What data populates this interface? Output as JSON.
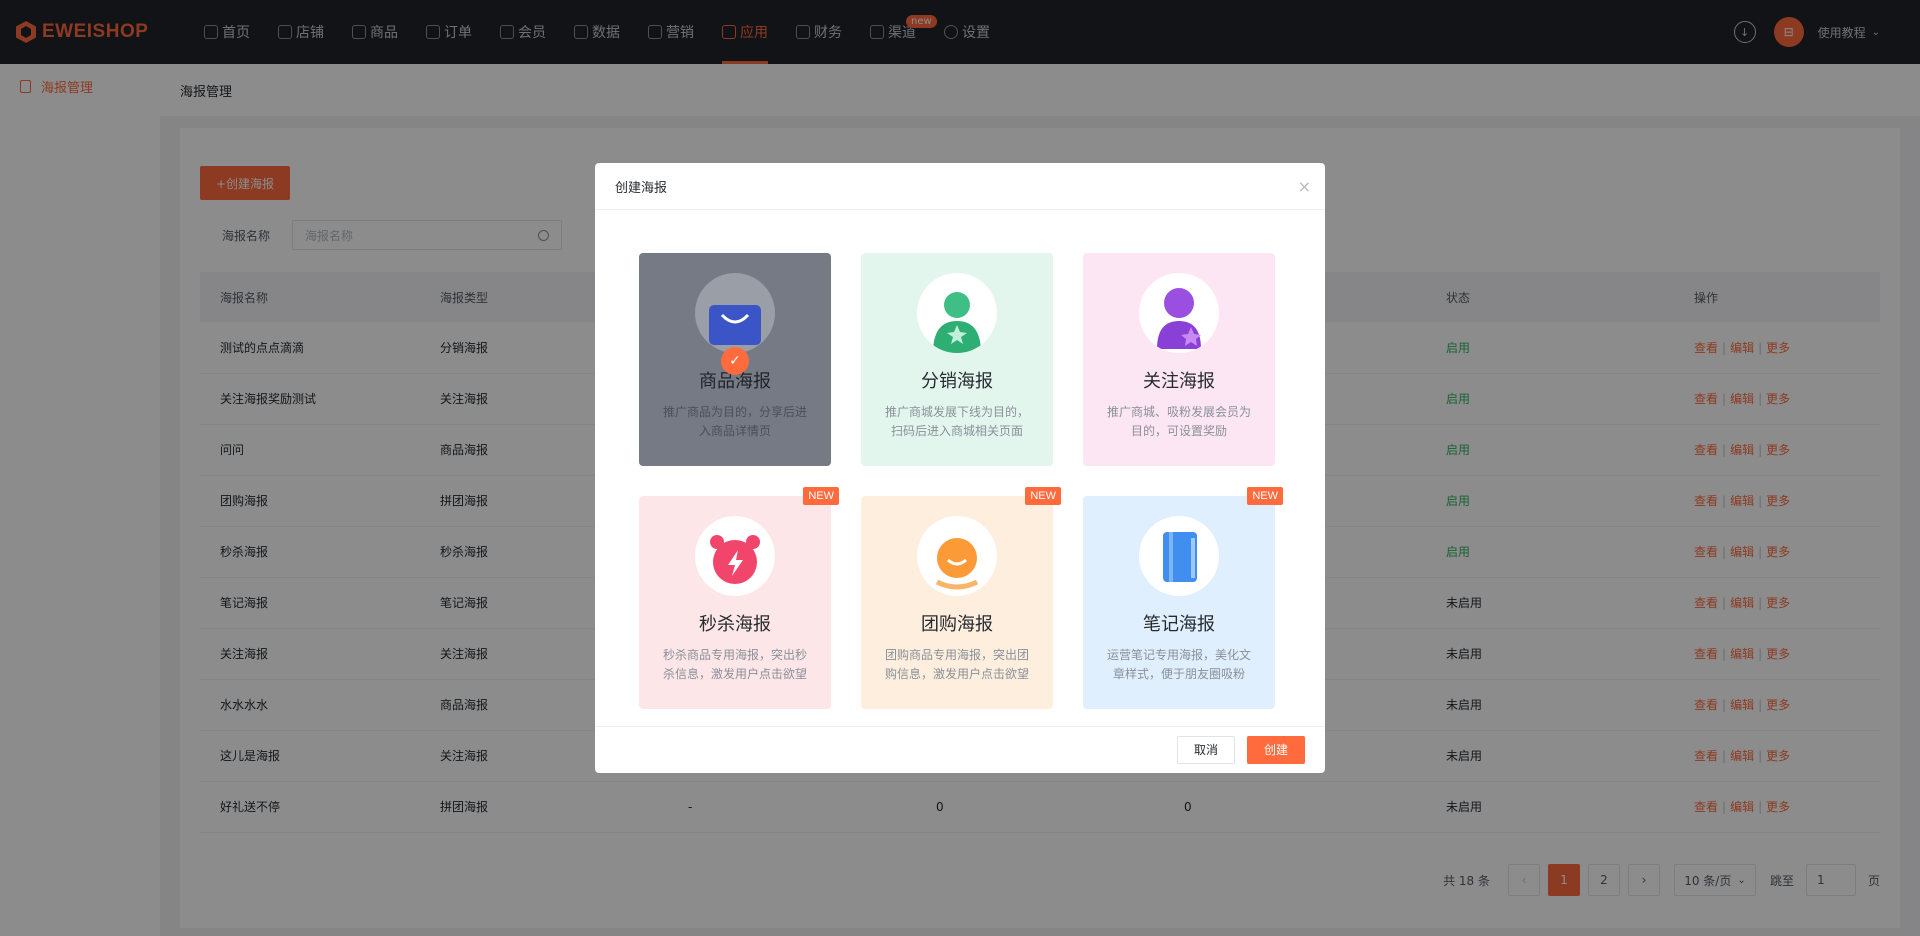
{
  "app": {
    "logo_text": "EWEISHOP"
  },
  "nav": {
    "items": [
      {
        "label": "首页",
        "icon": "home-icon"
      },
      {
        "label": "店铺",
        "icon": "store-icon"
      },
      {
        "label": "商品",
        "icon": "goods-icon"
      },
      {
        "label": "订单",
        "icon": "order-icon"
      },
      {
        "label": "会员",
        "icon": "member-icon"
      },
      {
        "label": "数据",
        "icon": "chart-icon"
      },
      {
        "label": "营销",
        "icon": "tag-icon"
      },
      {
        "label": "应用",
        "icon": "app-icon",
        "active": true
      },
      {
        "label": "财务",
        "icon": "finance-icon"
      },
      {
        "label": "渠道",
        "icon": "channel-icon",
        "badge": "new"
      },
      {
        "label": "设置",
        "icon": "settings-icon"
      }
    ],
    "help_label": "使用教程"
  },
  "sidebar": {
    "items": [
      {
        "label": "海报管理",
        "active": true
      }
    ]
  },
  "page": {
    "title": "海报管理",
    "create_button": "+创建海报",
    "filter_label": "海报名称",
    "search_placeholder": "海报名称"
  },
  "table": {
    "headers": [
      "海报名称",
      "海报类型",
      "",
      "",
      "",
      "状态",
      "操作"
    ],
    "rows": [
      {
        "name": "测试的点点滴滴",
        "type": "分销海报",
        "c3": "",
        "c4": "",
        "c5": "",
        "status": "启用"
      },
      {
        "name": "关注海报奖励测试",
        "type": "关注海报",
        "c3": "",
        "c4": "",
        "c5": "",
        "status": "启用"
      },
      {
        "name": "问问",
        "type": "商品海报",
        "c3": "",
        "c4": "",
        "c5": "",
        "status": "启用"
      },
      {
        "name": "团购海报",
        "type": "拼团海报",
        "c3": "",
        "c4": "",
        "c5": "",
        "status": "启用"
      },
      {
        "name": "秒杀海报",
        "type": "秒杀海报",
        "c3": "",
        "c4": "",
        "c5": "",
        "status": "启用"
      },
      {
        "name": "笔记海报",
        "type": "笔记海报",
        "c3": "",
        "c4": "",
        "c5": "",
        "status": "未启用"
      },
      {
        "name": "关注海报",
        "type": "关注海报",
        "c3": "",
        "c4": "",
        "c5": "",
        "status": "未启用"
      },
      {
        "name": "水水水水",
        "type": "商品海报",
        "c3": "",
        "c4": "",
        "c5": "",
        "status": "未启用"
      },
      {
        "name": "这儿是海报",
        "type": "关注海报",
        "c3": "",
        "c4": "",
        "c5": "",
        "status": "未启用"
      },
      {
        "name": "好礼送不停",
        "type": "拼团海报",
        "c3": "-",
        "c4": "0",
        "c5": "0",
        "status": "未启用"
      }
    ],
    "ops": {
      "view": "查看",
      "edit": "编辑",
      "more": "更多",
      "sep": "|"
    }
  },
  "pager": {
    "total": "共 18 条",
    "prev": "‹",
    "pages": [
      "1",
      "2"
    ],
    "next": "›",
    "size": "10 条/页",
    "jump_label": "跳至",
    "jump_value": "1",
    "page_suffix": "页"
  },
  "modal": {
    "title": "创建海报",
    "close": "×",
    "tiles": [
      {
        "title": "商品海报",
        "desc": "推广商品为目的，分享后进入商品详情页",
        "selected": true,
        "bg": "#767a84",
        "icon": "shopping-bag-icon"
      },
      {
        "title": "分销海报",
        "desc": "推广商城发展下线为目的，扫码后进入商城相关页面",
        "bg": "#e3f6ee",
        "icon": "distribution-icon"
      },
      {
        "title": "关注海报",
        "desc": "推广商城、吸粉发展会员为目的，可设置奖励",
        "bg": "#fde6f3",
        "icon": "follow-user-icon"
      },
      {
        "title": "秒杀海报",
        "desc": "秒杀商品专用海报，突出秒杀信息，激发用户点击欲望",
        "bg": "#fde6e8",
        "icon": "alarm-clock-icon",
        "tag": "NEW"
      },
      {
        "title": "团购海报",
        "desc": "团购商品专用海报，突出团购信息，激发用户点击欲望",
        "bg": "#fdeedd",
        "icon": "group-buy-icon",
        "tag": "NEW"
      },
      {
        "title": "笔记海报",
        "desc": "运营笔记专用海报，美化文章样式，便于朋友圈吸粉",
        "bg": "#e0effd",
        "icon": "notebook-icon",
        "tag": "NEW"
      }
    ],
    "cancel": "取消",
    "ok": "创建"
  },
  "colors": {
    "accent": "#ff6b3d",
    "topbar": "#1f2329",
    "status_on": "#2fb35d"
  }
}
